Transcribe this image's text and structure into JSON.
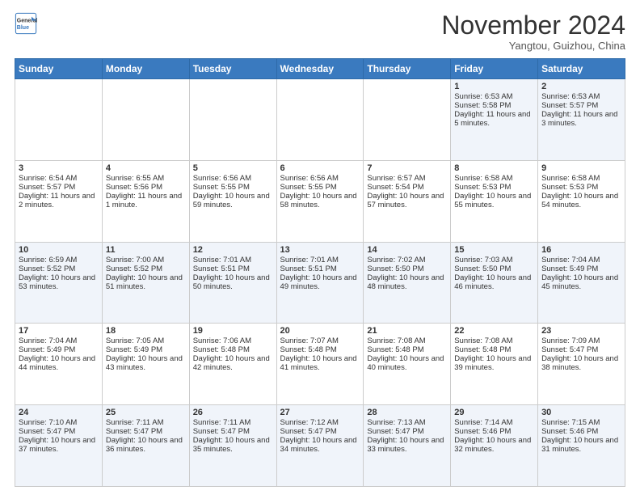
{
  "header": {
    "logo_line1": "General",
    "logo_line2": "Blue",
    "month": "November 2024",
    "location": "Yangtou, Guizhou, China"
  },
  "days_of_week": [
    "Sunday",
    "Monday",
    "Tuesday",
    "Wednesday",
    "Thursday",
    "Friday",
    "Saturday"
  ],
  "weeks": [
    [
      {
        "day": "",
        "info": ""
      },
      {
        "day": "",
        "info": ""
      },
      {
        "day": "",
        "info": ""
      },
      {
        "day": "",
        "info": ""
      },
      {
        "day": "",
        "info": ""
      },
      {
        "day": "1",
        "info": "Sunrise: 6:53 AM\nSunset: 5:58 PM\nDaylight: 11 hours and 5 minutes."
      },
      {
        "day": "2",
        "info": "Sunrise: 6:53 AM\nSunset: 5:57 PM\nDaylight: 11 hours and 3 minutes."
      }
    ],
    [
      {
        "day": "3",
        "info": "Sunrise: 6:54 AM\nSunset: 5:57 PM\nDaylight: 11 hours and 2 minutes."
      },
      {
        "day": "4",
        "info": "Sunrise: 6:55 AM\nSunset: 5:56 PM\nDaylight: 11 hours and 1 minute."
      },
      {
        "day": "5",
        "info": "Sunrise: 6:56 AM\nSunset: 5:55 PM\nDaylight: 10 hours and 59 minutes."
      },
      {
        "day": "6",
        "info": "Sunrise: 6:56 AM\nSunset: 5:55 PM\nDaylight: 10 hours and 58 minutes."
      },
      {
        "day": "7",
        "info": "Sunrise: 6:57 AM\nSunset: 5:54 PM\nDaylight: 10 hours and 57 minutes."
      },
      {
        "day": "8",
        "info": "Sunrise: 6:58 AM\nSunset: 5:53 PM\nDaylight: 10 hours and 55 minutes."
      },
      {
        "day": "9",
        "info": "Sunrise: 6:58 AM\nSunset: 5:53 PM\nDaylight: 10 hours and 54 minutes."
      }
    ],
    [
      {
        "day": "10",
        "info": "Sunrise: 6:59 AM\nSunset: 5:52 PM\nDaylight: 10 hours and 53 minutes."
      },
      {
        "day": "11",
        "info": "Sunrise: 7:00 AM\nSunset: 5:52 PM\nDaylight: 10 hours and 51 minutes."
      },
      {
        "day": "12",
        "info": "Sunrise: 7:01 AM\nSunset: 5:51 PM\nDaylight: 10 hours and 50 minutes."
      },
      {
        "day": "13",
        "info": "Sunrise: 7:01 AM\nSunset: 5:51 PM\nDaylight: 10 hours and 49 minutes."
      },
      {
        "day": "14",
        "info": "Sunrise: 7:02 AM\nSunset: 5:50 PM\nDaylight: 10 hours and 48 minutes."
      },
      {
        "day": "15",
        "info": "Sunrise: 7:03 AM\nSunset: 5:50 PM\nDaylight: 10 hours and 46 minutes."
      },
      {
        "day": "16",
        "info": "Sunrise: 7:04 AM\nSunset: 5:49 PM\nDaylight: 10 hours and 45 minutes."
      }
    ],
    [
      {
        "day": "17",
        "info": "Sunrise: 7:04 AM\nSunset: 5:49 PM\nDaylight: 10 hours and 44 minutes."
      },
      {
        "day": "18",
        "info": "Sunrise: 7:05 AM\nSunset: 5:49 PM\nDaylight: 10 hours and 43 minutes."
      },
      {
        "day": "19",
        "info": "Sunrise: 7:06 AM\nSunset: 5:48 PM\nDaylight: 10 hours and 42 minutes."
      },
      {
        "day": "20",
        "info": "Sunrise: 7:07 AM\nSunset: 5:48 PM\nDaylight: 10 hours and 41 minutes."
      },
      {
        "day": "21",
        "info": "Sunrise: 7:08 AM\nSunset: 5:48 PM\nDaylight: 10 hours and 40 minutes."
      },
      {
        "day": "22",
        "info": "Sunrise: 7:08 AM\nSunset: 5:48 PM\nDaylight: 10 hours and 39 minutes."
      },
      {
        "day": "23",
        "info": "Sunrise: 7:09 AM\nSunset: 5:47 PM\nDaylight: 10 hours and 38 minutes."
      }
    ],
    [
      {
        "day": "24",
        "info": "Sunrise: 7:10 AM\nSunset: 5:47 PM\nDaylight: 10 hours and 37 minutes."
      },
      {
        "day": "25",
        "info": "Sunrise: 7:11 AM\nSunset: 5:47 PM\nDaylight: 10 hours and 36 minutes."
      },
      {
        "day": "26",
        "info": "Sunrise: 7:11 AM\nSunset: 5:47 PM\nDaylight: 10 hours and 35 minutes."
      },
      {
        "day": "27",
        "info": "Sunrise: 7:12 AM\nSunset: 5:47 PM\nDaylight: 10 hours and 34 minutes."
      },
      {
        "day": "28",
        "info": "Sunrise: 7:13 AM\nSunset: 5:47 PM\nDaylight: 10 hours and 33 minutes."
      },
      {
        "day": "29",
        "info": "Sunrise: 7:14 AM\nSunset: 5:46 PM\nDaylight: 10 hours and 32 minutes."
      },
      {
        "day": "30",
        "info": "Sunrise: 7:15 AM\nSunset: 5:46 PM\nDaylight: 10 hours and 31 minutes."
      }
    ]
  ]
}
